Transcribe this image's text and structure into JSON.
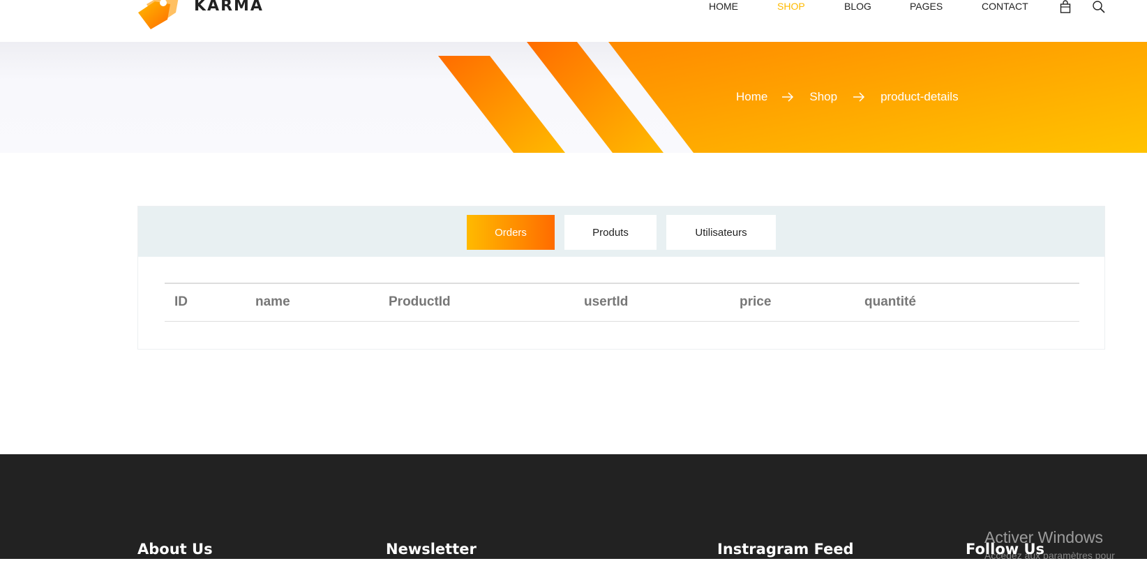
{
  "header": {
    "brand": "KARMA",
    "nav": [
      {
        "label": "HOME"
      },
      {
        "label": "SHOP"
      },
      {
        "label": "BLOG"
      },
      {
        "label": "PAGES"
      },
      {
        "label": "CONTACT"
      }
    ],
    "active_nav": "SHOP",
    "icons": [
      "cart-icon",
      "search-icon"
    ]
  },
  "banner": {
    "breadcrumb": [
      "Home",
      "Shop",
      "product-details"
    ]
  },
  "tabs": {
    "items": [
      {
        "label": "Orders"
      },
      {
        "label": "Produts"
      },
      {
        "label": "Utilisateurs"
      }
    ],
    "active": "Orders"
  },
  "table": {
    "columns": [
      "ID",
      "name",
      "ProductId",
      "usertId",
      "price",
      "quantité"
    ],
    "rows": []
  },
  "footer": {
    "headings": [
      "About Us",
      "Newsletter",
      "Instragram Feed",
      "Follow Us"
    ]
  },
  "os_overlay": {
    "watermark_title": "Activer Windows",
    "watermark_subtitle": "Accédez aux paramètres pour"
  },
  "colors": {
    "accent": "#ffba00",
    "accent_dark": "#ff6c00",
    "tabbar_bg": "#e8f0f2",
    "footer_bg": "#222222"
  }
}
